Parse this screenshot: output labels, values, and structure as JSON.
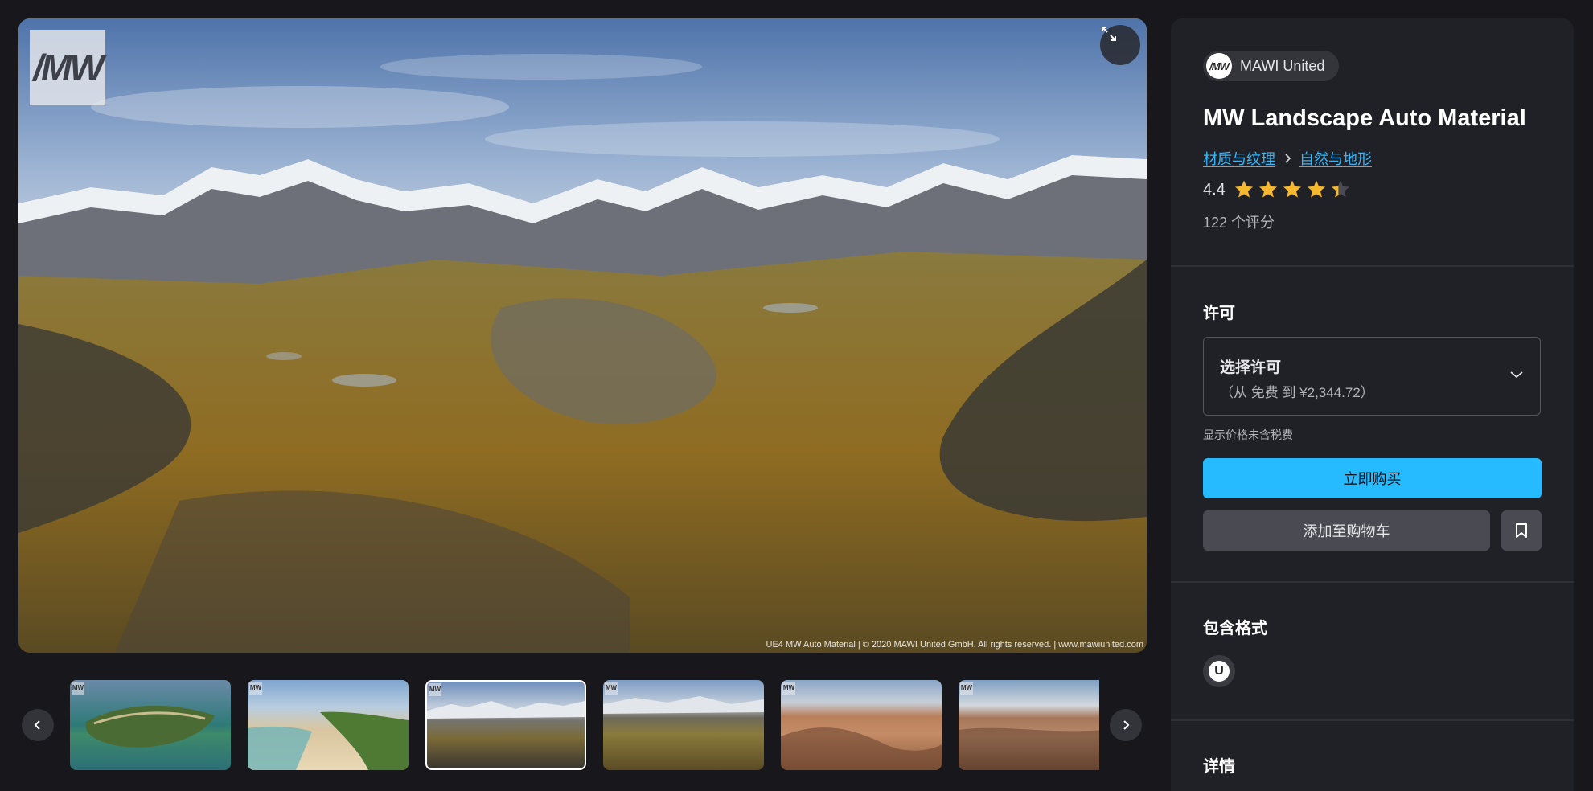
{
  "gallery": {
    "logo_text": "/MW",
    "caption": "UE4 MW Auto Material | © 2020 MAWI United GmbH. All rights reserved. | www.mawiunited.com",
    "thumb_logo": "MW",
    "thumbnails": [
      {
        "theme": "island"
      },
      {
        "theme": "beach"
      },
      {
        "theme": "mountain",
        "active": true
      },
      {
        "theme": "meadow"
      },
      {
        "theme": "desert"
      },
      {
        "theme": "desert-wide"
      }
    ],
    "icons": {
      "fullscreen": "expand-icon",
      "prev": "chevron-left-icon",
      "next": "chevron-right-icon"
    }
  },
  "product": {
    "seller": {
      "avatar_text": "/MW",
      "name": "MAWI United"
    },
    "title": "MW Landscape Auto Material",
    "breadcrumb": [
      "材质与纹理",
      "自然与地形"
    ],
    "rating": {
      "value": "4.4",
      "stars": 4.4,
      "reviews": "122 个评分"
    },
    "license": {
      "heading": "许可",
      "select_label": "选择许可",
      "price_range": "（从 免费 到 ¥2,344.72）",
      "tax_note": "显示价格未含税费"
    },
    "buttons": {
      "buy": "立即购买",
      "add_to_cart": "添加至购物车"
    },
    "formats": {
      "heading": "包含格式",
      "icon_text": "U"
    },
    "details": {
      "heading": "详情"
    }
  },
  "colors": {
    "accent": "#26bbff",
    "link": "#32b8ff",
    "star": "#f5b82e",
    "panel_bg": "#202126",
    "page_bg": "#18181c"
  }
}
